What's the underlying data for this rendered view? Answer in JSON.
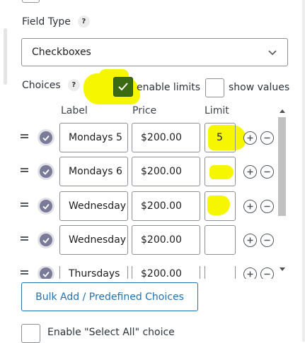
{
  "field_type": {
    "label": "Field Type",
    "help": "?",
    "selected": "Checkboxes"
  },
  "choices": {
    "label": "Choices",
    "help": "?",
    "enable_limits": {
      "label": "enable limits",
      "checked": true
    },
    "show_values": {
      "label": "show values",
      "checked": false
    },
    "columns": [
      "Label",
      "Price",
      "Limit"
    ],
    "rows": [
      {
        "label": "Mondays 5",
        "price": "$200.00",
        "limit": "5"
      },
      {
        "label": "Mondays 6",
        "price": "$200.00",
        "limit": ""
      },
      {
        "label": "Wednesday",
        "price": "$200.00",
        "limit": ""
      },
      {
        "label": "Wednesday",
        "price": "$200.00",
        "limit": ""
      },
      {
        "label": "Thursdays",
        "price": "$200.00",
        "limit": ""
      }
    ]
  },
  "bulk_add_label": "Bulk Add / Predefined Choices",
  "select_all": {
    "label": "Enable \"Select All\" choice",
    "checked": false
  },
  "colors": {
    "accent": "#2271b1",
    "highlight": "#f6f600",
    "checked": "#3a6a12",
    "default_icon": "#797b99"
  }
}
